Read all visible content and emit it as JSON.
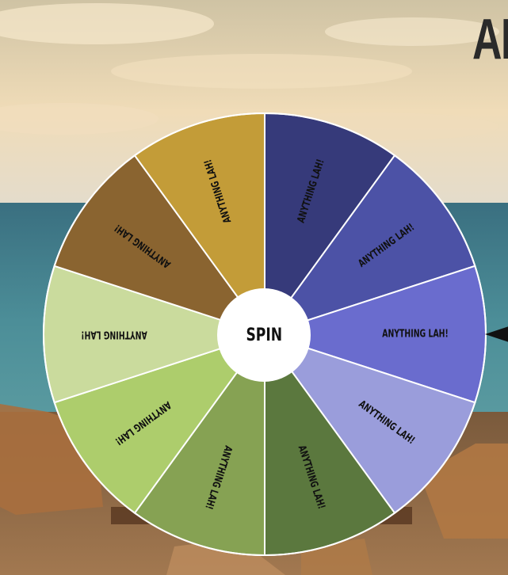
{
  "page": {
    "heading": "AN"
  },
  "wheel": {
    "spin_label": "SPIN",
    "segment_label": "ANYTHING LAH!",
    "segments": [
      {
        "label": "ANYTHING LAH!",
        "color": "#363a7a",
        "text_color": "#111111"
      },
      {
        "label": "ANYTHING LAH!",
        "color": "#4c52a6",
        "text_color": "#111111"
      },
      {
        "label": "ANYTHING LAH!",
        "color": "#6a6cce",
        "text_color": "#111111"
      },
      {
        "label": "ANYTHING LAH!",
        "color": "#9a9ddb",
        "text_color": "#111111"
      },
      {
        "label": "ANYTHING LAH!",
        "color": "#5b783e",
        "text_color": "#111111"
      },
      {
        "label": "ANYTHING LAH!",
        "color": "#86a253",
        "text_color": "#111111"
      },
      {
        "label": "ANYTHING LAH!",
        "color": "#adcd6c",
        "text_color": "#111111"
      },
      {
        "label": "ANYTHING LAH!",
        "color": "#cadb9d",
        "text_color": "#111111"
      },
      {
        "label": "ANYTHING LAH!",
        "color": "#8a6430",
        "text_color": "#111111"
      },
      {
        "label": "ANYTHING LAH!",
        "color": "#c39c38",
        "text_color": "#111111"
      }
    ],
    "pointer_icon": "triangle-pointer-icon"
  },
  "background": {
    "sky_color": "#e8d8b8",
    "sea_color": "#3f7e8c"
  }
}
